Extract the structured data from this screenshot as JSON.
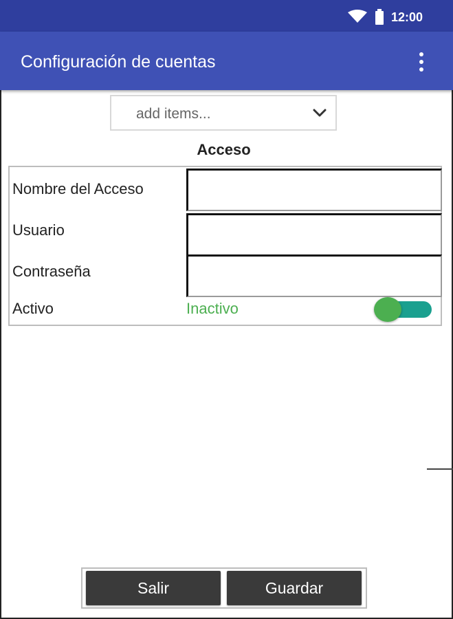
{
  "status_bar": {
    "time": "12:00",
    "icons": [
      "wifi-icon",
      "battery-icon"
    ],
    "color": "#2f3e9e"
  },
  "app_bar": {
    "title": "Configuración de cuentas",
    "menu_icon": "more-vert-icon",
    "color": "#3f51b5"
  },
  "picker": {
    "placeholder": "add items...",
    "icon": "chevron-down-icon"
  },
  "form": {
    "title": "Acceso",
    "fields": [
      {
        "label": "Nombre del Acceso",
        "value": ""
      },
      {
        "label": "Usuario",
        "value": ""
      },
      {
        "label": "Contraseña",
        "value": ""
      }
    ],
    "active": {
      "label": "Activo",
      "state_text": "Inactivo",
      "state_color": "#4caf50",
      "toggle_track_color": "#1aa08f"
    }
  },
  "buttons": {
    "exit": "Salir",
    "save": "Guardar",
    "color": "#3a3a3a"
  }
}
